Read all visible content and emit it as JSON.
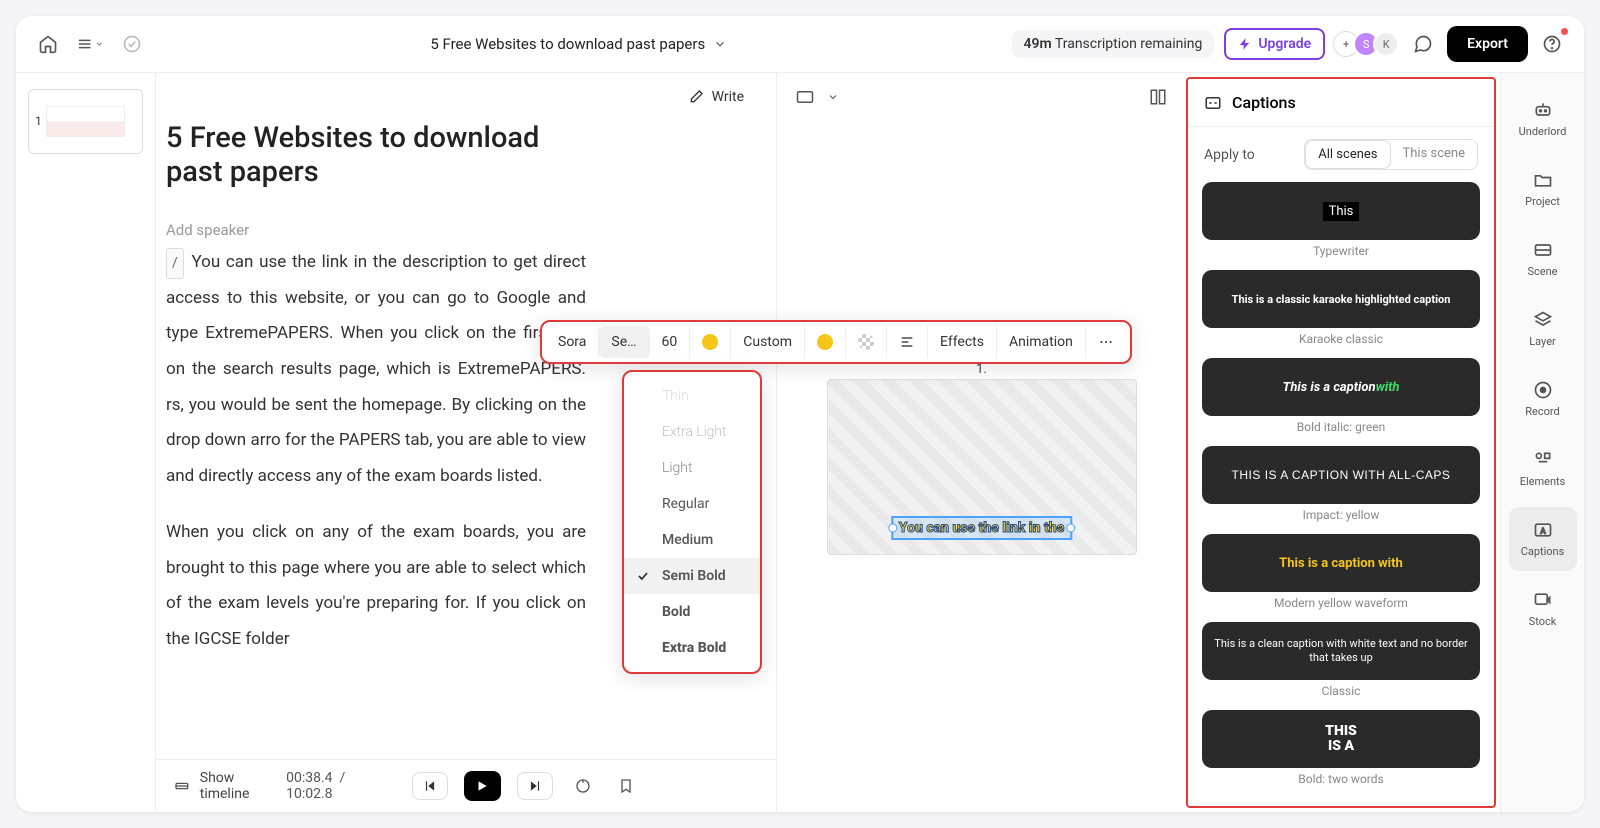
{
  "topbar": {
    "title": "5 Free Websites to download past papers",
    "time_remaining": "49m",
    "status_label": "Transcription remaining",
    "upgrade_label": "Upgrade",
    "export_label": "Export",
    "avatar1": "S",
    "avatar2": "K"
  },
  "thumb": {
    "number": "1"
  },
  "editor": {
    "write_label": "Write",
    "doc_title": "5 Free Websites to download past papers",
    "add_speaker": "Add speaker",
    "slash": "/",
    "p1": "You can use the link in the description to get direct access to this website, or you can go to Google and type ExtremePAPERS. When you click on the first link on the search results page, which is ExtremePAPERS. rs, you would be sent the homepage. By clicking on the drop down arro for the PAPERS tab, you are able to view and directly access any of the exam boards listed.",
    "p2": "When you click on any of the exam boards, you are brought to this page where you are able to select which of the exam levels you're preparing for. If you click on the IGCSE folder"
  },
  "preview": {
    "scene_num": "1.",
    "caption_text": "You can use the link in the"
  },
  "toolbar": {
    "font": "Sora",
    "weight_short": "Se…",
    "size": "60",
    "custom": "Custom",
    "effects": "Effects",
    "animation": "Animation"
  },
  "weights": {
    "thin": "Thin",
    "elight": "Extra Light",
    "light": "Light",
    "regular": "Regular",
    "medium": "Medium",
    "semibold": "Semi Bold",
    "bold": "Bold",
    "ebold": "Extra Bold"
  },
  "captions": {
    "header": "Captions",
    "apply_to": "Apply to",
    "all_scenes": "All scenes",
    "this_scene": "This scene",
    "styles": [
      {
        "label": "Typewriter",
        "preview": "This"
      },
      {
        "label": "Karaoke classic",
        "preview": "This is a classic karaoke highlighted caption"
      },
      {
        "label": "Bold italic: green",
        "preview_a": "This is a caption ",
        "preview_b": "with"
      },
      {
        "label": "Impact: yellow",
        "preview": "THIS IS A CAPTION WITH ALL-CAPS"
      },
      {
        "label": "Modern yellow waveform",
        "preview": "This is a caption with"
      },
      {
        "label": "Classic",
        "preview": "This is a clean caption with white text and no border that takes up"
      },
      {
        "label": "Bold: two words",
        "preview_a": "THIS",
        "preview_b": "IS A"
      }
    ]
  },
  "rail": {
    "underlord": "Underlord",
    "project": "Project",
    "scene": "Scene",
    "layer": "Layer",
    "record": "Record",
    "elements": "Elements",
    "captions": "Captions",
    "stock": "Stock"
  },
  "footer": {
    "timeline": "Show timeline",
    "time_current": "00:38.4",
    "time_total": "10:02.8"
  }
}
